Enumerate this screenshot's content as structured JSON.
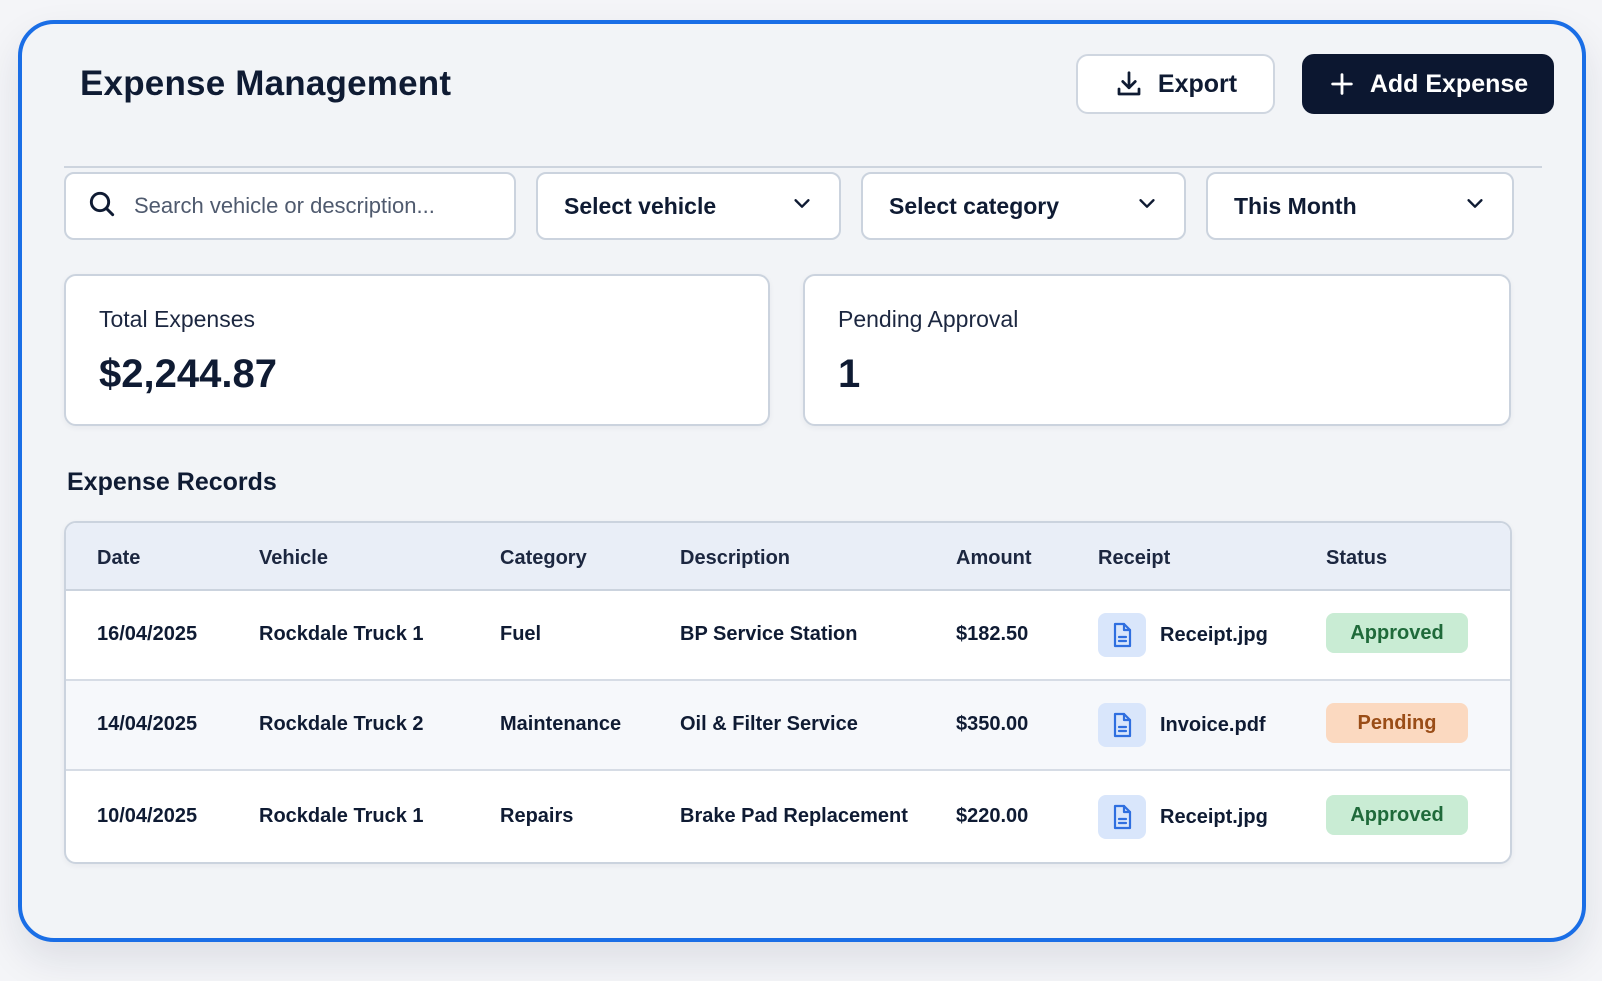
{
  "header": {
    "title": "Expense Management",
    "export_label": "Export",
    "add_label": "Add Expense"
  },
  "filters": {
    "search_placeholder": "Search vehicle or description...",
    "vehicle_select": "Select vehicle",
    "category_select": "Select category",
    "period_select": "This Month"
  },
  "summary": {
    "total_label": "Total Expenses",
    "total_value": "$2,244.87",
    "pending_label": "Pending Approval",
    "pending_value": "1"
  },
  "records": {
    "title": "Expense Records",
    "columns": [
      "Date",
      "Vehicle",
      "Category",
      "Description",
      "Amount",
      "Receipt",
      "Status"
    ],
    "rows": [
      {
        "date": "16/04/2025",
        "vehicle": "Rockdale Truck 1",
        "category": "Fuel",
        "description": "BP Service Station",
        "amount": "$182.50",
        "receipt": "Receipt.jpg",
        "status": "Approved"
      },
      {
        "date": "14/04/2025",
        "vehicle": "Rockdale Truck 2",
        "category": "Maintenance",
        "description": "Oil & Filter Service",
        "amount": "$350.00",
        "receipt": "Invoice.pdf",
        "status": "Pending"
      },
      {
        "date": "10/04/2025",
        "vehicle": "Rockdale Truck 1",
        "category": "Repairs",
        "description": "Brake Pad Replacement",
        "amount": "$220.00",
        "receipt": "Receipt.jpg",
        "status": "Approved"
      }
    ]
  },
  "icons": {
    "export": "download-icon",
    "add": "plus-icon",
    "search": "search-icon",
    "dropdown": "chevron-down-icon",
    "file": "file-icon"
  },
  "colors": {
    "accent_border": "#1a6ee6",
    "primary_button": "#0c1730",
    "approved_bg": "#c9ecd4",
    "approved_text": "#1f6a3a",
    "pending_bg": "#fbd9c0",
    "pending_text": "#9a4d17",
    "file_icon": "#2f6fe0"
  }
}
